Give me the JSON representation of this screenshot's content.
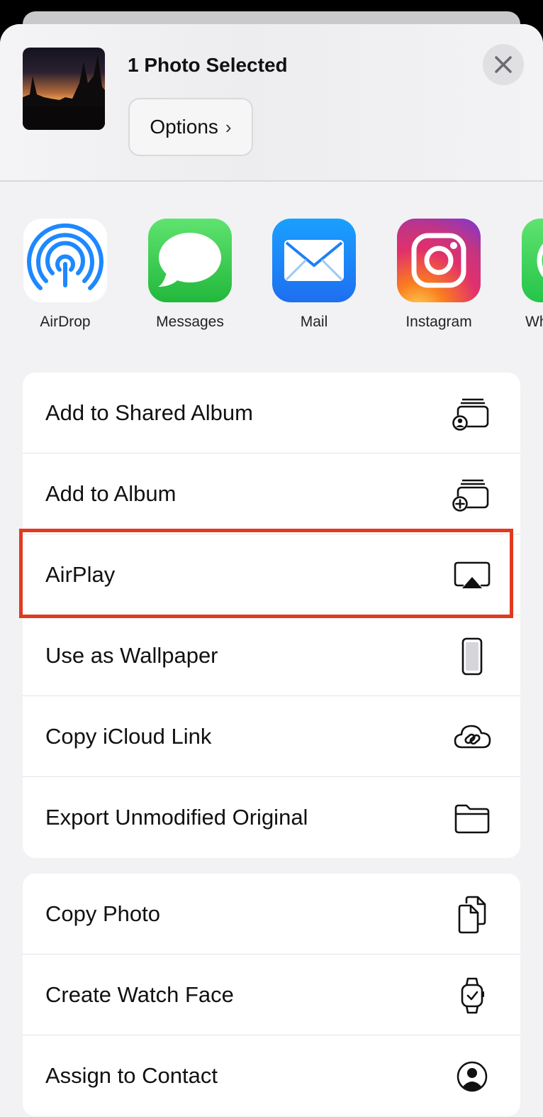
{
  "header": {
    "title": "1 Photo Selected",
    "options_label": "Options",
    "close_icon": "close-icon"
  },
  "apps": [
    {
      "label": "AirDrop",
      "icon": "airdrop-icon"
    },
    {
      "label": "Messages",
      "icon": "messages-icon"
    },
    {
      "label": "Mail",
      "icon": "mail-icon"
    },
    {
      "label": "Instagram",
      "icon": "instagram-icon"
    },
    {
      "label": "Wh",
      "icon": "whatsapp-icon"
    }
  ],
  "actions_group1": [
    {
      "label": "Add to Shared Album",
      "icon": "shared-album-icon"
    },
    {
      "label": "Add to Album",
      "icon": "add-album-icon"
    },
    {
      "label": "AirPlay",
      "icon": "airplay-icon"
    },
    {
      "label": "Use as Wallpaper",
      "icon": "phone-icon"
    },
    {
      "label": "Copy iCloud Link",
      "icon": "icloud-link-icon"
    },
    {
      "label": "Export Unmodified Original",
      "icon": "folder-icon"
    }
  ],
  "actions_group2": [
    {
      "label": "Copy Photo",
      "icon": "copy-icon"
    },
    {
      "label": "Create Watch Face",
      "icon": "watch-icon"
    },
    {
      "label": "Assign to Contact",
      "icon": "contact-icon"
    }
  ],
  "highlighted_action": "AirPlay",
  "colors": {
    "highlight": "#e03a20",
    "airdrop": "#1e88ff",
    "messages": "#33c748",
    "mail": "#1e90ff"
  }
}
